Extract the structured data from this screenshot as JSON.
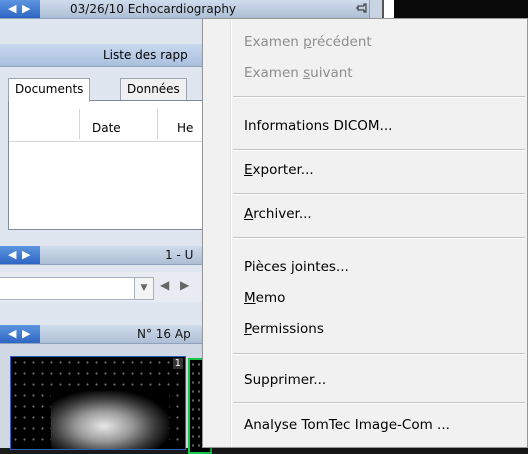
{
  "panel": {
    "header1_title": "03/26/10 Echocardiography",
    "sub_title": "Liste des rapp",
    "tabs": [
      {
        "label": "Documents"
      },
      {
        "label": "Données"
      }
    ],
    "columns": [
      {
        "label": "Date"
      },
      {
        "label": "He"
      }
    ],
    "header2_title": "1 - U",
    "header3_title": "N° 16 Ap",
    "thumb_number": "1"
  },
  "icons": {
    "nav_left": "◀",
    "nav_right": "▶",
    "pin": "pin-icon",
    "combo_dropdown": "▼",
    "nav_prev": "◀",
    "nav_next": "▶"
  },
  "context_menu": {
    "items": [
      {
        "pre": "Examen ",
        "u": "p",
        "post": "récédent",
        "enabled": false
      },
      {
        "pre": "Examen ",
        "u": "s",
        "post": "uivant",
        "enabled": false
      },
      {
        "pre": "Informations DICOM...",
        "u": "",
        "post": "",
        "enabled": true
      },
      {
        "pre": "",
        "u": "E",
        "post": "xporter...",
        "enabled": true
      },
      {
        "pre": "",
        "u": "A",
        "post": "rchiver...",
        "enabled": true
      },
      {
        "pre": "Pièces jointes...",
        "u": "",
        "post": "",
        "enabled": true
      },
      {
        "pre": "",
        "u": "M",
        "post": "emo",
        "enabled": true
      },
      {
        "pre": "",
        "u": "P",
        "post": "ermissions",
        "enabled": true
      },
      {
        "pre": "Supprimer...",
        "u": "",
        "post": "",
        "enabled": true
      },
      {
        "pre": "Analyse TomTec Image-Com ...",
        "u": "",
        "post": "",
        "enabled": true
      }
    ]
  },
  "colors": {
    "menu_bg": "#f1f1f1",
    "disabled_text": "#8d8d8d",
    "nav_blue": "#2e66c4",
    "selection_green": "#17c64a"
  }
}
